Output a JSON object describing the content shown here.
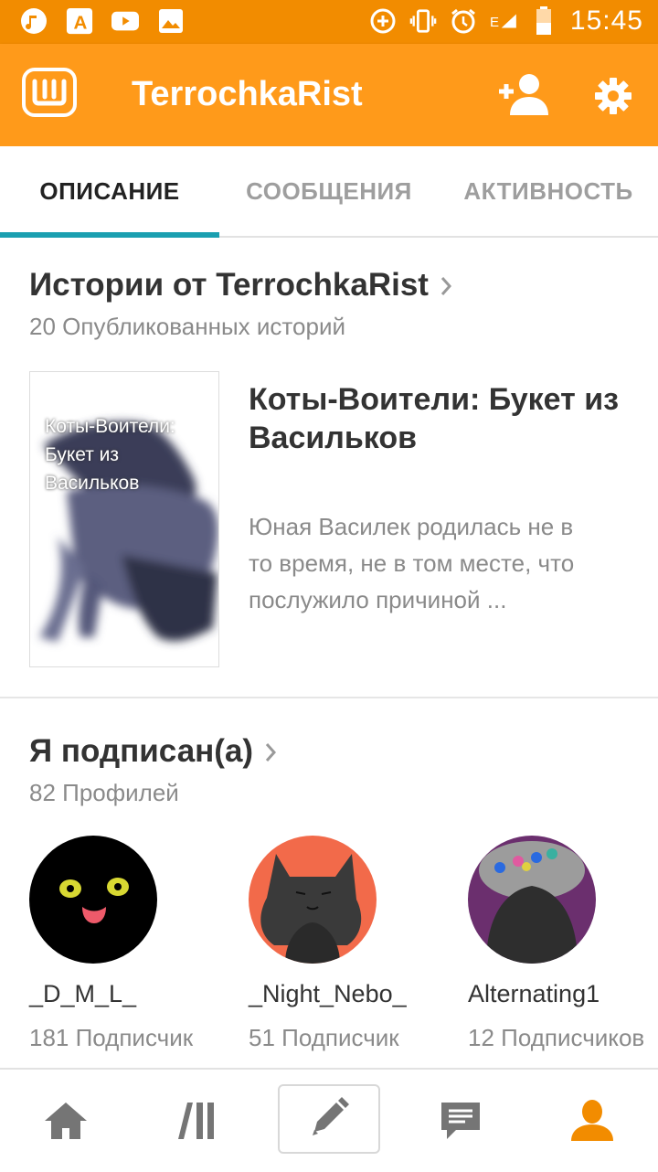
{
  "status_bar": {
    "time": "15:45",
    "left_icons": [
      "music-icon",
      "font-app-icon",
      "youtube-icon",
      "gallery-icon"
    ],
    "right_icons": [
      "data-saver-icon",
      "vibrate-icon",
      "alarm-icon",
      "signal-icon",
      "battery-icon"
    ],
    "network": "E"
  },
  "app_bar": {
    "logo_icon": "wattpad-logo-icon",
    "title": "TerrochkaRist",
    "color": "#ff9a1a"
  },
  "tabs": [
    {
      "label": "ОПИСАНИЕ",
      "active": true
    },
    {
      "label": "СООБЩЕНИЯ",
      "active": false
    },
    {
      "label": "АКТИВНОСТЬ",
      "active": false
    }
  ],
  "stories": {
    "title": "Истории от TerrochkaRist",
    "subtitle": "20 Опубликованных историй",
    "item": {
      "cover_text": "Коты-Воители: Букет из Васильков",
      "title": "Коты-Воители: Букет из Васильков",
      "description": "Юная Василек родилась не в то время, не в том месте, что послужило причиной ..."
    }
  },
  "following": {
    "title": "Я подписан(а)",
    "subtitle": "82 Профилей",
    "profiles": [
      {
        "name": "_D_M_L_",
        "count": "181 Подписчик"
      },
      {
        "name": "_Night_Nebo_",
        "count": "51 Подписчик"
      },
      {
        "name": "Alternating1",
        "count": "12 Подписчиков"
      }
    ]
  },
  "bottom_nav": [
    "home-icon",
    "library-icon",
    "write-icon",
    "messages-icon",
    "profile-icon"
  ],
  "colors": {
    "accent": "#ff9a1a",
    "tab_indicator": "#1a9fb0",
    "active_nav": "#f28c00"
  }
}
